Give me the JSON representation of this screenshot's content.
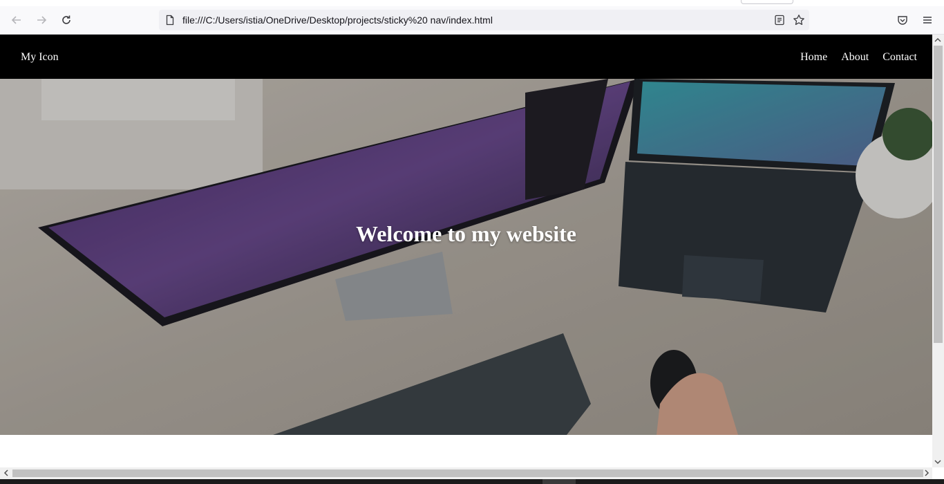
{
  "browser": {
    "url": "file:///C:/Users/istia/OneDrive/Desktop/projects/sticky%20 nav/index.html",
    "icons": {
      "back": "arrow-left-icon",
      "forward": "arrow-right-icon",
      "reload": "reload-icon",
      "page": "page-icon",
      "reader": "reader-view-icon",
      "bookmark": "star-icon",
      "pocket": "pocket-icon",
      "menu": "hamburger-menu-icon"
    }
  },
  "site": {
    "brand": "My Icon",
    "nav": [
      {
        "label": "Home"
      },
      {
        "label": "About"
      },
      {
        "label": "Contact"
      }
    ],
    "hero_title": "Welcome to my website"
  }
}
